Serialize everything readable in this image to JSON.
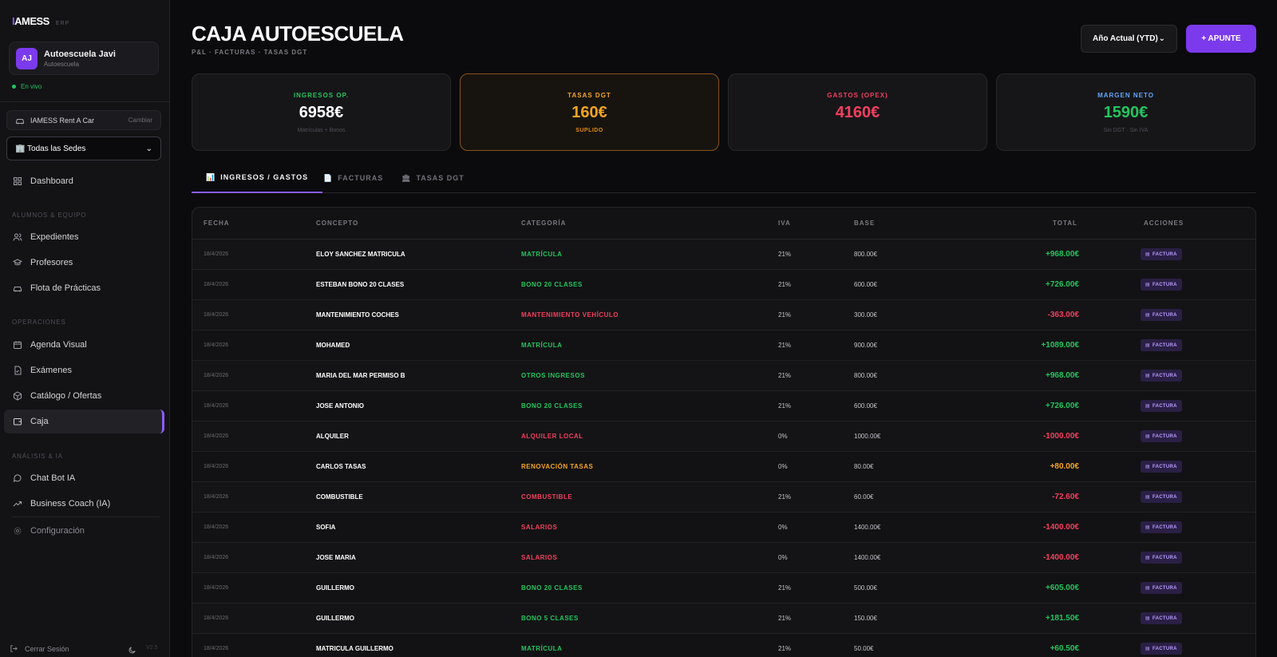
{
  "brand": {
    "name_prefix": "I",
    "name_rest": "AMESS",
    "sub": "ERP"
  },
  "org": {
    "initials": "AJ",
    "name": "Autoescuela Javi",
    "type": "Autoescuela"
  },
  "status": {
    "live_label": "En vivo"
  },
  "company": {
    "name": "IAMESS Rent A Car",
    "change_label": "Cambiar"
  },
  "sede": {
    "selected": "🏢 Todas las Sedes"
  },
  "nav": {
    "dashboard": "Dashboard",
    "section_students": "Alumnos & Equipo",
    "expedientes": "Expedientes",
    "profesores": "Profesores",
    "flota": "Flota de Prácticas",
    "section_ops": "Operaciones",
    "agenda": "Agenda Visual",
    "examenes": "Exámenes",
    "catalogo": "Catálogo / Ofertas",
    "caja": "Caja",
    "section_ai": "Análisis & IA",
    "chatbot": "Chat Bot IA",
    "coach": "Business Coach (IA)",
    "config": "Configuración",
    "logout": "Cerrar Sesión",
    "version": "V2.5"
  },
  "header": {
    "title": "CAJA AUTOESCUELA",
    "subtitle": "P&L · FACTURAS · TASAS DGT",
    "period": "Año Actual (YTD)",
    "add_label": "+ APUNTE"
  },
  "kpis": {
    "ingresos": {
      "label": "INGRESOS OP.",
      "value": "6958€",
      "note": "Matrículas + Bonos",
      "color": "#22c55e"
    },
    "tasas": {
      "label": "TASAS DGT",
      "value": "160€",
      "note": "SUPLIDO",
      "color": "#f5a524"
    },
    "gastos": {
      "label": "GASTOS (OPEX)",
      "value": "4160€",
      "note": "",
      "color": "#f43f5e"
    },
    "margen": {
      "label": "MARGEN NETO",
      "value": "1590€",
      "note": "Sin DGT · Sin IVA",
      "color": "#22c55e",
      "label_color": "#60a5fa"
    }
  },
  "tabs": {
    "ingresos": "INGRESOS / GASTOS",
    "facturas": "FACTURAS",
    "tasas": "TASAS DGT"
  },
  "table": {
    "headers": {
      "fecha": "FECHA",
      "concepto": "CONCEPTO",
      "categoria": "CATEGORÍA",
      "iva": "IVA",
      "base": "BASE",
      "total": "TOTAL",
      "acciones": "ACCIONES"
    },
    "action_label": "FACTURA",
    "rows": [
      {
        "fecha": "18/4/2026",
        "concepto": "ELOY SANCHEZ MATRICULA",
        "categoria": "MATRÍCULA",
        "tipo": "ingreso",
        "iva": "21%",
        "base": "800.00€",
        "total": "+968.00€"
      },
      {
        "fecha": "18/4/2026",
        "concepto": "ESTEBAN BONO 20 CLASES",
        "categoria": "BONO 20 CLASES",
        "tipo": "ingreso",
        "iva": "21%",
        "base": "600.00€",
        "total": "+726.00€"
      },
      {
        "fecha": "18/4/2026",
        "concepto": "MANTENIMIENTO COCHES",
        "categoria": "MANTENIMIENTO VEHÍCULO",
        "tipo": "gasto",
        "iva": "21%",
        "base": "300.00€",
        "total": "-363.00€"
      },
      {
        "fecha": "18/4/2026",
        "concepto": "MOHAMED",
        "categoria": "MATRÍCULA",
        "tipo": "ingreso",
        "iva": "21%",
        "base": "900.00€",
        "total": "+1089.00€"
      },
      {
        "fecha": "18/4/2026",
        "concepto": "MARIA DEL MAR PERMISO B",
        "categoria": "OTROS INGRESOS",
        "tipo": "ingreso",
        "iva": "21%",
        "base": "800.00€",
        "total": "+968.00€"
      },
      {
        "fecha": "18/4/2026",
        "concepto": "JOSE ANTONIO",
        "categoria": "BONO 20 CLASES",
        "tipo": "ingreso",
        "iva": "21%",
        "base": "600.00€",
        "total": "+726.00€"
      },
      {
        "fecha": "18/4/2026",
        "concepto": "ALQUILER",
        "categoria": "ALQUILER LOCAL",
        "tipo": "gasto",
        "iva": "0%",
        "base": "1000.00€",
        "total": "-1000.00€"
      },
      {
        "fecha": "18/4/2026",
        "concepto": "CARLOS TASAS",
        "categoria": "RENOVACIÓN TASAS",
        "tipo": "tasa",
        "iva": "0%",
        "base": "80.00€",
        "total": "+80.00€"
      },
      {
        "fecha": "18/4/2026",
        "concepto": "COMBUSTIBLE",
        "categoria": "COMBUSTIBLE",
        "tipo": "gasto",
        "iva": "21%",
        "base": "60.00€",
        "total": "-72.60€"
      },
      {
        "fecha": "18/4/2026",
        "concepto": "SOFIA",
        "categoria": "SALARIOS",
        "tipo": "gasto",
        "iva": "0%",
        "base": "1400.00€",
        "total": "-1400.00€"
      },
      {
        "fecha": "18/4/2026",
        "concepto": "JOSE MARIA",
        "categoria": "SALARIOS",
        "tipo": "gasto",
        "iva": "0%",
        "base": "1400.00€",
        "total": "-1400.00€"
      },
      {
        "fecha": "18/4/2026",
        "concepto": "GUILLERMO",
        "categoria": "BONO 20 CLASES",
        "tipo": "ingreso",
        "iva": "21%",
        "base": "500.00€",
        "total": "+605.00€"
      },
      {
        "fecha": "18/4/2026",
        "concepto": "GUILLERMO",
        "categoria": "BONO 5 CLASES",
        "tipo": "ingreso",
        "iva": "21%",
        "base": "150.00€",
        "total": "+181.50€"
      },
      {
        "fecha": "18/4/2026",
        "concepto": "MATRICULA GUILLERMO",
        "categoria": "MATRÍCULA",
        "tipo": "ingreso",
        "iva": "21%",
        "base": "50.00€",
        "total": "+60.50€"
      }
    ]
  },
  "colors": {
    "ingreso": "#22c55e",
    "gasto": "#f43f5e",
    "tasa": "#f5a524",
    "accent": "#7c3aed"
  }
}
